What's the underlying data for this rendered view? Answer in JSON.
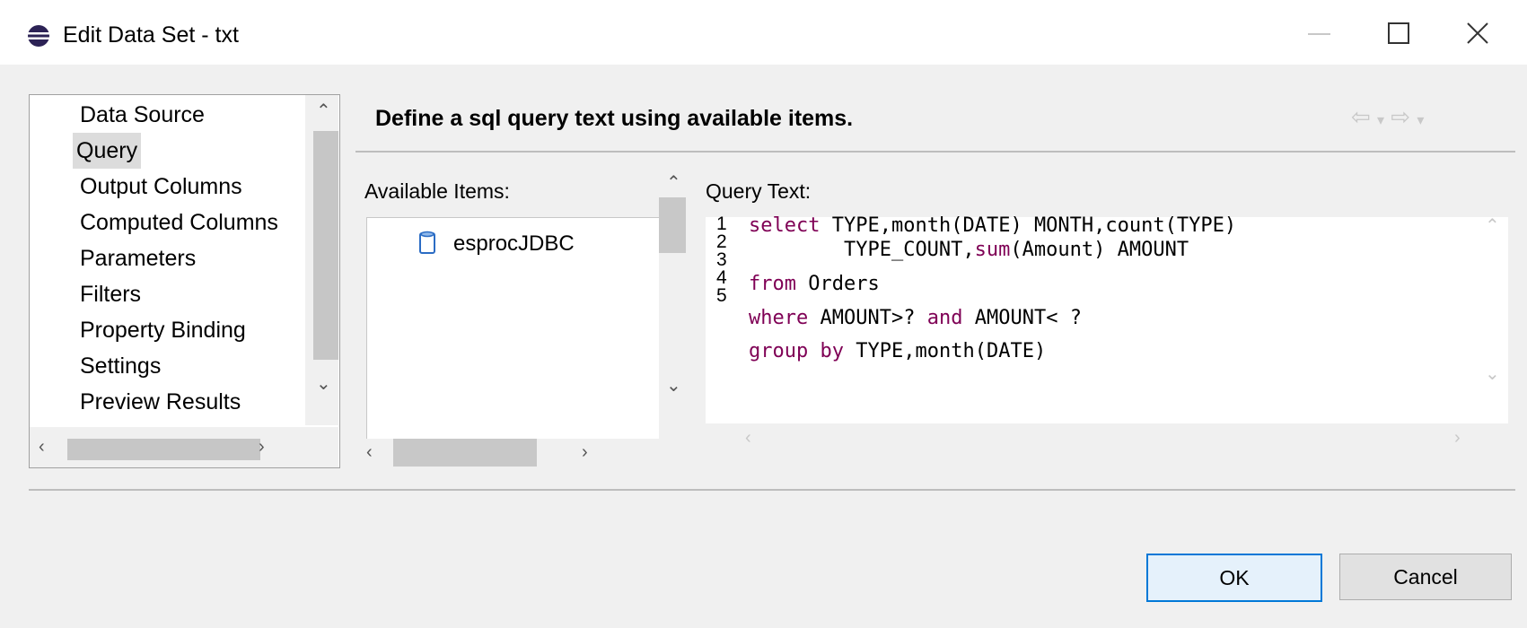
{
  "window": {
    "title": "Edit Data Set - txt",
    "icon": "eclipse-icon"
  },
  "nav": {
    "items": [
      {
        "label": "Data Source"
      },
      {
        "label": "Query",
        "selected": true
      },
      {
        "label": "Output Columns"
      },
      {
        "label": "Computed Columns"
      },
      {
        "label": "Parameters"
      },
      {
        "label": "Filters"
      },
      {
        "label": "Property Binding"
      },
      {
        "label": "Settings"
      },
      {
        "label": "Preview Results"
      }
    ]
  },
  "main": {
    "header": "Define a sql query text using available items.",
    "available_items": {
      "label": "Available Items:",
      "items": [
        {
          "label": "esprocJDBC",
          "icon": "database-icon"
        }
      ]
    },
    "query": {
      "label": "Query Text:",
      "line_numbers": [
        "1",
        "2",
        "3",
        "4",
        "5"
      ],
      "lines": [
        "select TYPE,month(DATE) MONTH,count(TYPE)",
        "        TYPE_COUNT,sum(Amount) AMOUNT",
        "from Orders",
        "where AMOUNT>? and AMOUNT< ?",
        "group by TYPE,month(DATE)"
      ],
      "keyword_color": "#7f0055"
    }
  },
  "buttons": {
    "ok": "OK",
    "cancel": "Cancel"
  }
}
